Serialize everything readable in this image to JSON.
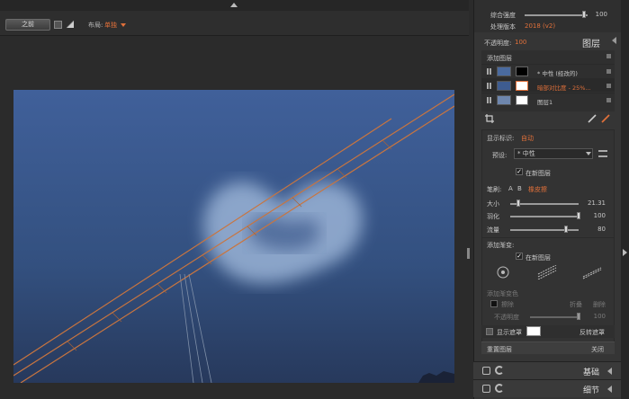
{
  "toolbar": {
    "before_label": "之前",
    "layout_label": "布局:",
    "layout_value": "单独"
  },
  "panel": {
    "overall_strength_label": "综合强度",
    "overall_strength_value": "100",
    "overall_strength_fraction": 0.94,
    "process_version_label": "处理版本",
    "process_version_value": "2018 (v2)",
    "opacity_label": "不透明度:",
    "opacity_value": "100",
    "layers_title": "图层",
    "add_layer_label": "添加图层",
    "layers": [
      {
        "name": "* 中性 (经改的)",
        "active": false
      },
      {
        "name": "暗部对比度 - 25%...",
        "active": true
      },
      {
        "name": "图层1",
        "active": false
      }
    ],
    "display_mask_label": "显示标识:",
    "display_mask_value": "自动",
    "preset_label": "预设:",
    "preset_value": "* 中性",
    "new_layer_label": "在新图层",
    "brush_label": "笔刷:",
    "brush_a": "A",
    "brush_b": "B",
    "brush_eraser": "橡皮擦",
    "size_label": "大小",
    "size_value": "21.31",
    "size_fraction": 0.12,
    "feather_label": "羽化",
    "feather_value": "100",
    "feather_fraction": 1.0,
    "flow_label": "流量",
    "flow_value": "80",
    "flow_fraction": 0.82,
    "add_gradient_label": "添加渐变:",
    "gradient_new_layer_label": "在新图层",
    "gradient_color_label": "添加渐变色",
    "erase_label": "擦除",
    "fold_label": "折叠",
    "delete_label": "删除",
    "gradient_opacity_label": "不透明度",
    "gradient_opacity_value": "100",
    "gradient_opacity_fraction": 1.0,
    "show_mask_label": "显示遮罩",
    "invert_mask_label": "反转遮罩",
    "reset_layer_label": "重置图层",
    "close_label": "关闭"
  },
  "bottom_tabs": [
    {
      "label": "基础"
    },
    {
      "label": "细节"
    }
  ],
  "colors": {
    "accent": "#e0703a",
    "sky_top": "#3d5c8e",
    "sky_bottom": "#2a3f66",
    "crane": "#c9753f"
  }
}
